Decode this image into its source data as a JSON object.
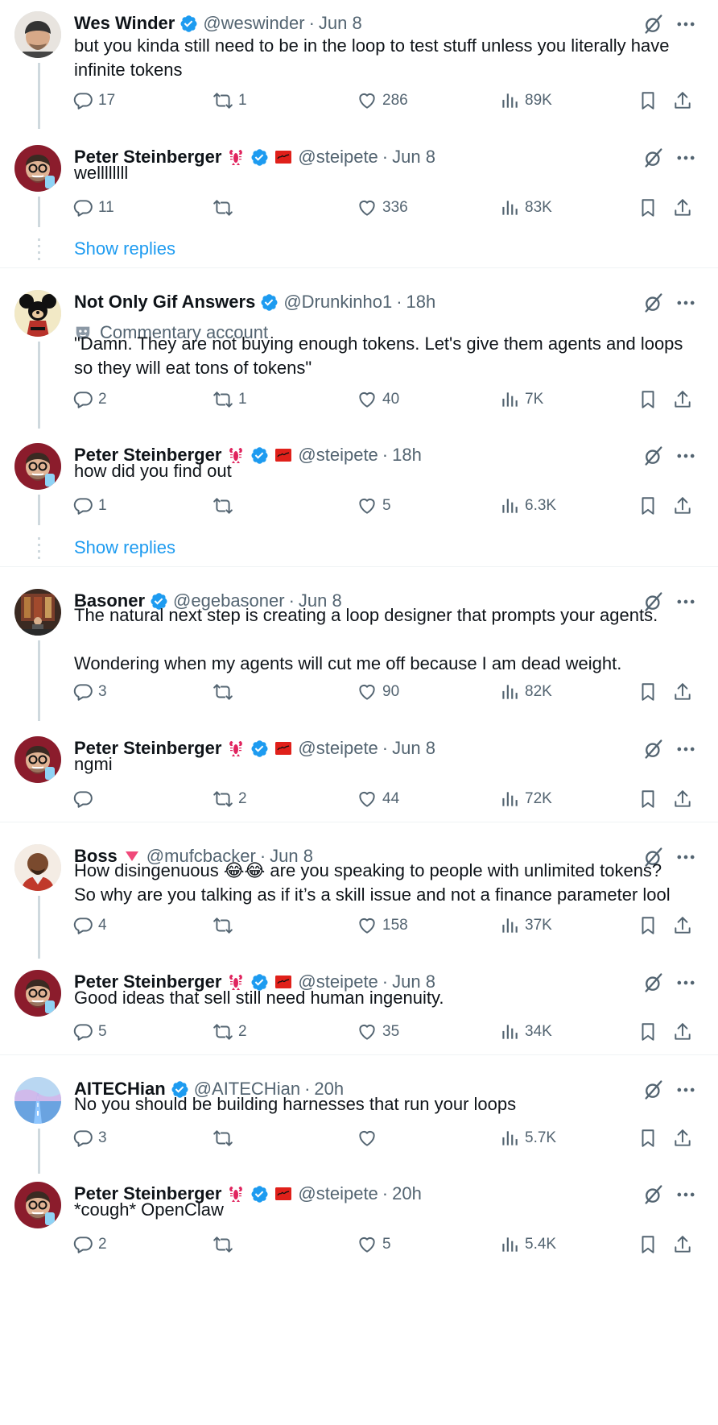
{
  "colors": {
    "accent": "#1d9bf0",
    "text": "#0f1419",
    "muted": "#536471",
    "line": "#cfd9de",
    "verified": "#1d9bf0"
  },
  "tweets": [
    {
      "name": "Wes Winder",
      "handle": "@weswinder",
      "sep": "·",
      "time": "Jun 8",
      "verified": true,
      "emoji": [],
      "text": "but you kinda still need to be in the loop to test stuff unless you literally have infinite tokens",
      "replies": "17",
      "reposts": "1",
      "likes": "286",
      "views": "89K",
      "avatar_icon": "avatar-man-beanie"
    },
    {
      "name": "Peter Steinberger",
      "handle": "@steipete",
      "sep": "·",
      "time": "Jun 8",
      "verified": true,
      "emoji": [
        "lobster-emoji",
        "signature-badge"
      ],
      "text": "wellllllll",
      "replies": "11",
      "reposts": "",
      "likes": "336",
      "views": "83K",
      "avatar_icon": "avatar-man-glasses"
    },
    {
      "name": "Not Only Gif Answers",
      "handle": "@Drunkinho1",
      "sep": "·",
      "time": "18h",
      "verified": true,
      "emoji": [],
      "label": "Commentary account",
      "text": "\"Damn. They are not buying enough tokens. Let's give them agents and loops so they will eat tons of tokens\"",
      "replies": "2",
      "reposts": "1",
      "likes": "40",
      "views": "7K",
      "avatar_icon": "avatar-mouse"
    },
    {
      "name": "Peter Steinberger",
      "handle": "@steipete",
      "sep": "·",
      "time": "18h",
      "verified": true,
      "emoji": [
        "lobster-emoji",
        "signature-badge"
      ],
      "text": "how did you find out",
      "replies": "1",
      "reposts": "",
      "likes": "5",
      "views": "6.3K",
      "avatar_icon": "avatar-man-glasses"
    },
    {
      "name": "Basoner",
      "handle": "@egebasoner",
      "sep": "·",
      "time": "Jun 8",
      "verified": true,
      "emoji": [],
      "text": "The natural next step is creating a loop designer that prompts your agents.\n\nWondering when my agents will cut me off because I am dead weight.",
      "replies": "3",
      "reposts": "",
      "likes": "90",
      "views": "82K",
      "avatar_icon": "avatar-room"
    },
    {
      "name": "Peter Steinberger",
      "handle": "@steipete",
      "sep": "·",
      "time": "Jun 8",
      "verified": true,
      "emoji": [
        "lobster-emoji",
        "signature-badge"
      ],
      "text": "ngmi",
      "replies": "",
      "reposts": "2",
      "likes": "44",
      "views": "72K",
      "avatar_icon": "avatar-man-glasses"
    },
    {
      "name": "Boss",
      "handle": "@mufcbacker",
      "sep": "·",
      "time": "Jun 8",
      "verified": false,
      "emoji": [
        "red-triangle-emoji"
      ],
      "text": "How disingenuous 😂😂 are you speaking to people with unlimited tokens? So why are you talking as if it’s a skill issue and not a finance parameter lool",
      "replies": "4",
      "reposts": "",
      "likes": "158",
      "views": "37K",
      "avatar_icon": "avatar-bald-man"
    },
    {
      "name": "Peter Steinberger",
      "handle": "@steipete",
      "sep": "·",
      "time": "Jun 8",
      "verified": true,
      "emoji": [
        "lobster-emoji",
        "signature-badge"
      ],
      "text": "Good ideas that sell still need human ingenuity.",
      "replies": "5",
      "reposts": "2",
      "likes": "35",
      "views": "34K",
      "avatar_icon": "avatar-man-glasses"
    },
    {
      "name": "AITECHian",
      "handle": "@AITECHian",
      "sep": "·",
      "time": "20h",
      "verified": true,
      "emoji": [],
      "text": "No you should be building harnesses that run your loops",
      "replies": "3",
      "reposts": "",
      "likes": "",
      "views": "5.7K",
      "avatar_icon": "avatar-road"
    },
    {
      "name": "Peter Steinberger",
      "handle": "@steipete",
      "sep": "·",
      "time": "20h",
      "verified": true,
      "emoji": [
        "lobster-emoji",
        "signature-badge"
      ],
      "text": "*cough* OpenClaw",
      "replies": "2",
      "reposts": "",
      "likes": "5",
      "views": "5.4K",
      "avatar_icon": "avatar-man-glasses"
    }
  ],
  "show_replies": "Show replies",
  "icons": [
    "grok-icon",
    "more-icon",
    "reply-icon",
    "repost-icon",
    "like-icon",
    "views-icon",
    "bookmark-icon",
    "share-icon",
    "verified-icon",
    "commentary-mask-icon"
  ]
}
